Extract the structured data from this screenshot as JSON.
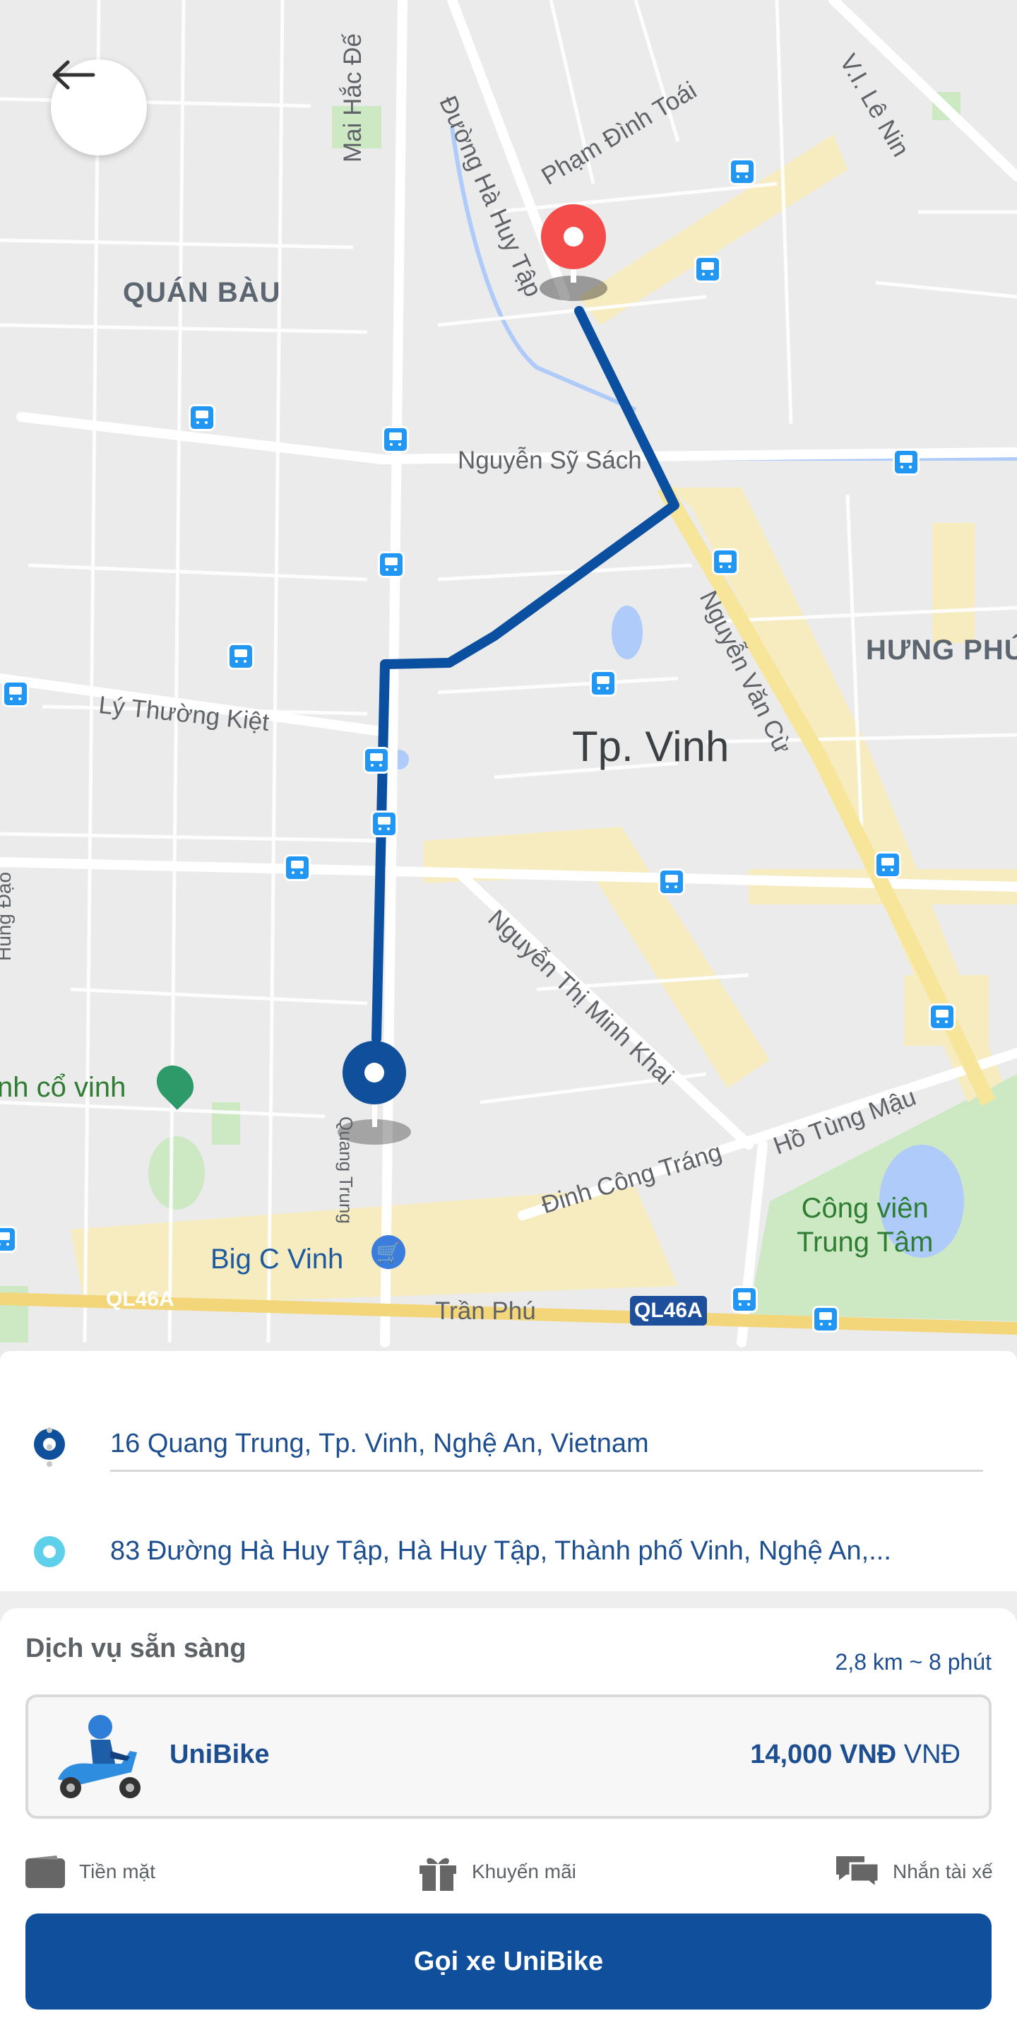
{
  "map": {
    "districts": [
      "QUÁN BÀU",
      "HƯNG PHÚ"
    ],
    "city": "Tp. Vinh",
    "streets": [
      "Mai Hắc Đế",
      "Đường Hà Huy Tập",
      "Phạm Đình Toái",
      "V.I. Lê Nin",
      "Nguyễn Sỹ Sách",
      "Nguyễn Văn Cừ",
      "Lý Thường Kiệt",
      "Nguyễn Thị Minh Khai",
      "Hồ Tùng Mậu",
      "Đinh Công Tráng",
      "Trần Phú",
      "QL46A",
      "Quang Trung",
      "Hùng Đạo"
    ],
    "highway_shield": "QL46A",
    "pois": {
      "temple": "nh cổ vinh",
      "mall": "Big C Vinh",
      "park_line1": "Công viên",
      "park_line2": "Trung Tâm"
    },
    "colors": {
      "route": "#0b4fa0",
      "destination_pin": "#f44b4b",
      "origin_pin": "#0f4f9b"
    }
  },
  "route": {
    "origin": "16 Quang Trung, Tp. Vinh, Nghệ An, Vietnam",
    "destination": "83 Đường Hà Huy Tập, Hà Huy Tập, Thành phố Vinh, Nghệ An,..."
  },
  "service": {
    "title": "Dịch vụ sẵn sàng",
    "eta": "2,8 km ~ 8 phút",
    "name": "UniBike",
    "price": "14,000 VNĐ",
    "currency": "VNĐ",
    "options": [
      {
        "label": "Tiền mặt",
        "icon": "wallet-icon"
      },
      {
        "label": "Khuyến mãi",
        "icon": "gift-icon"
      },
      {
        "label": "Nhắn tài xế",
        "icon": "chat-icon"
      }
    ],
    "call_button": "Gọi xe UniBike"
  },
  "icons": {
    "back": "back-arrow-icon",
    "bus": "bus-stop-icon",
    "vehicle": "scooter-icon"
  }
}
